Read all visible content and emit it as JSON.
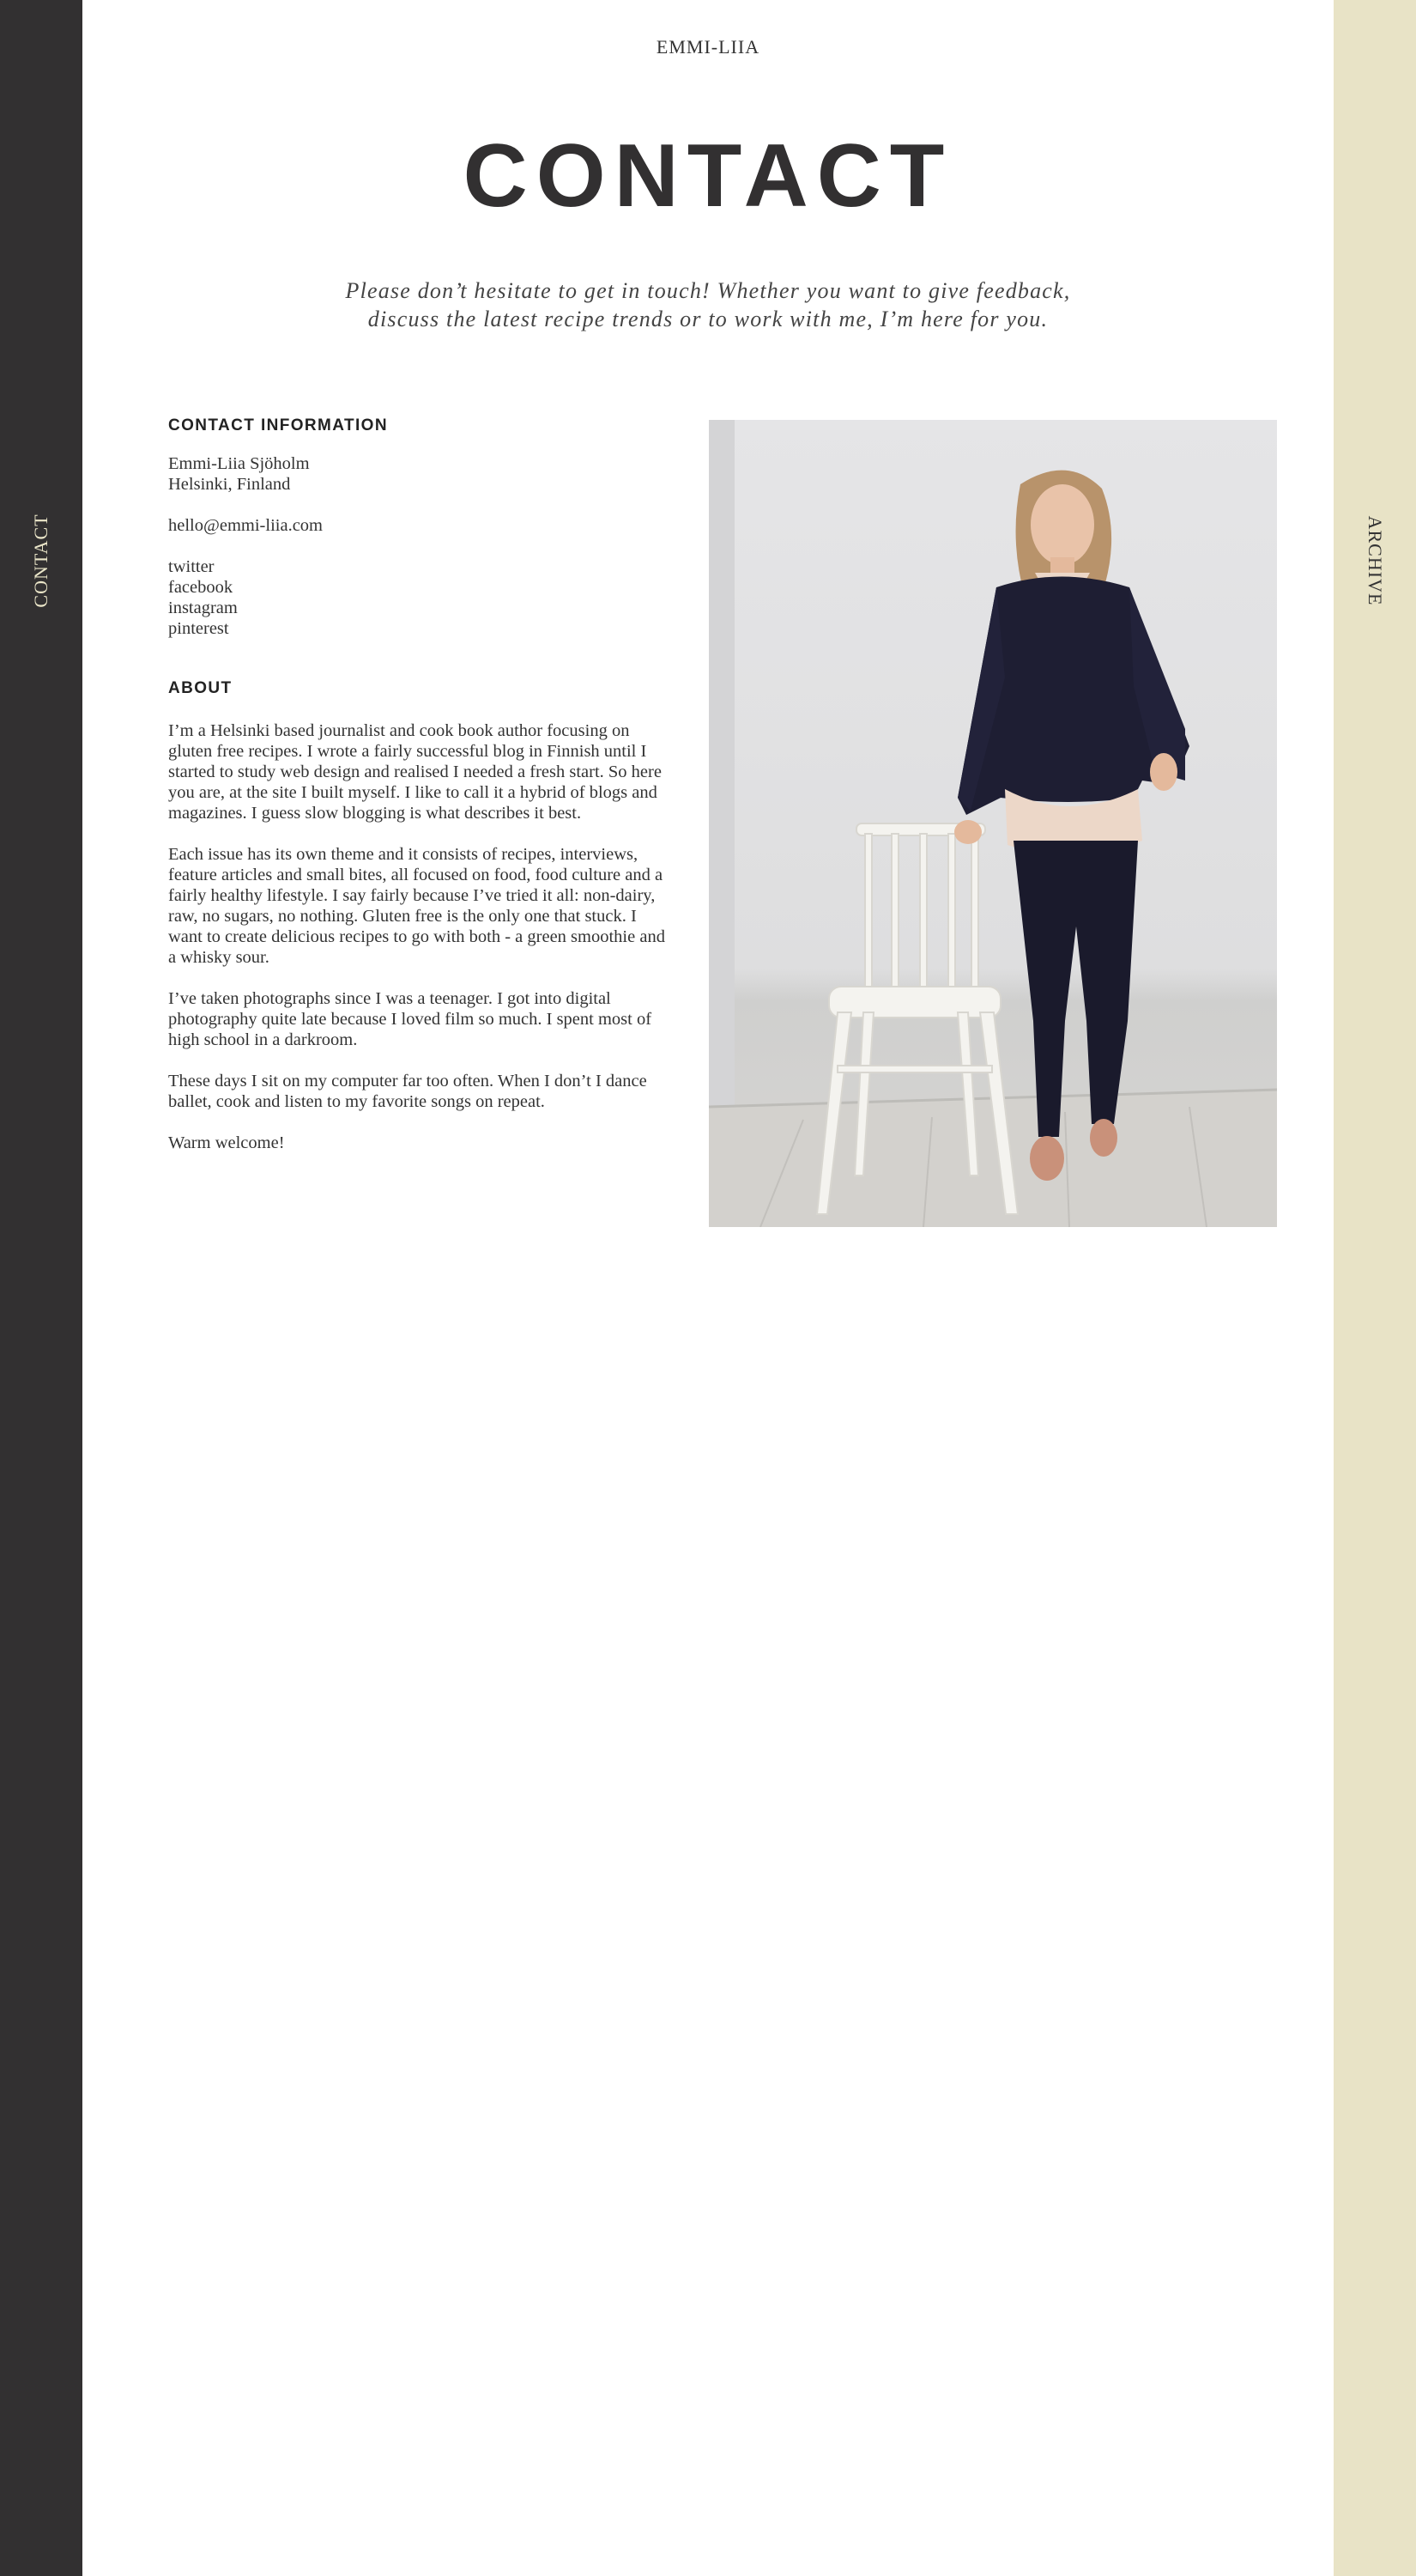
{
  "site": {
    "name": "EMMI-LIIA"
  },
  "nav": {
    "left_label": "CONTACT",
    "right_label": "ARCHIVE"
  },
  "page": {
    "title": "CONTACT",
    "intro_line1": "Please don’t hesitate to get in touch! Whether you want to give feedback,",
    "intro_line2": "discuss the latest recipe trends or to work with me, I’m here for you."
  },
  "contact": {
    "heading": "CONTACT INFORMATION",
    "name": "Emmi-Liia Sjöholm",
    "location": "Helsinki, Finland",
    "email": "hello@emmi-liia.com",
    "social": [
      "twitter",
      "facebook",
      "instagram",
      "pinterest"
    ]
  },
  "about": {
    "heading": "ABOUT",
    "paragraphs": [
      "I’m a Helsinki based journalist and cook book author focusing on gluten free recipes. I wrote a fairly successful blog in Finnish until I started to study web design and realised I needed a fresh start. So here you are, at the site I built myself. I like to call it a hybrid of blogs and magazines. I guess slow blogging is what describes it best.",
      "Each issue has its own theme and it consists of recipes, interviews, feature articles and small bites, all focused on food, food culture and a fairly healthy lifestyle. I say fairly because I’ve tried it all: non-dairy, raw, no sugars, no nothing. Gluten free is the only one that stuck. I want to create delicious recipes to go with both - a green smoothie and a whisky sour.",
      "I’ve taken photographs since I was a teenager. I got into digital photography quite late because I loved film so much. I spent most of high school in a darkroom.",
      "These days I sit on my computer far too often. When I don’t I dance ballet, cook and listen to my favorite songs on repeat.",
      "Warm welcome!"
    ]
  },
  "colors": {
    "left_sidebar": "#323031",
    "right_sidebar": "#e8e3c6",
    "text": "#333333",
    "background": "#ffffff"
  }
}
